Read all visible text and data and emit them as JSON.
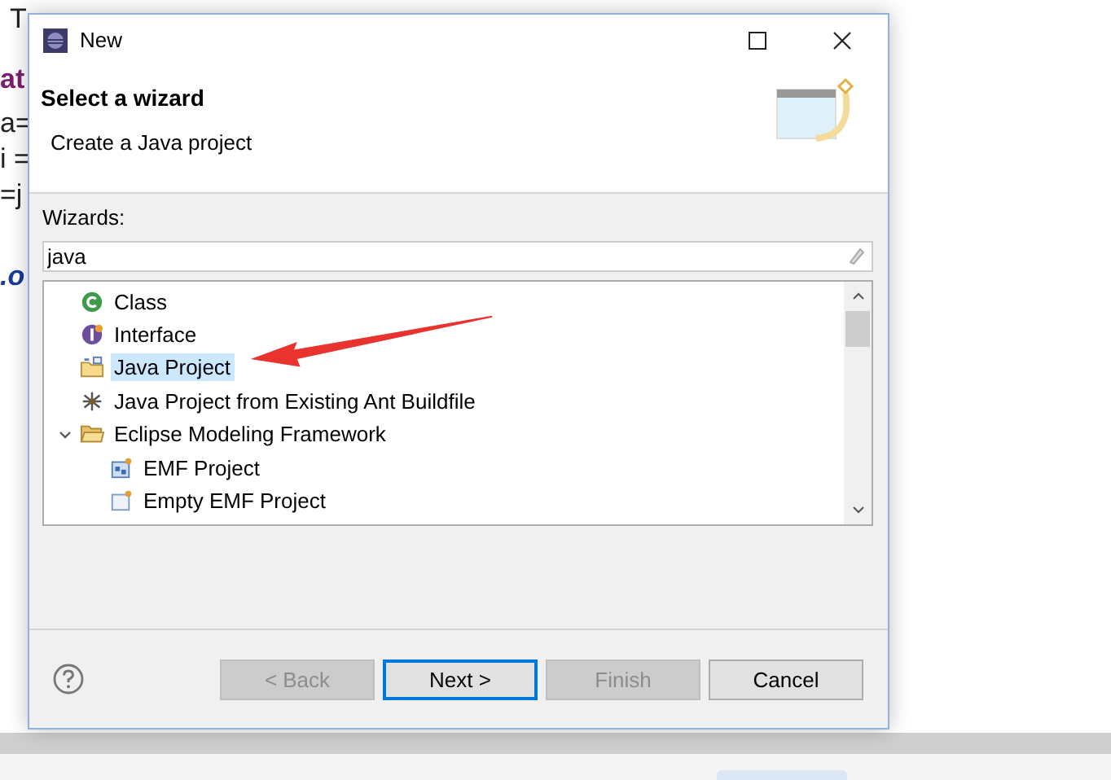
{
  "editor_fragments": [
    {
      "text": "T",
      "kind": "plain"
    },
    {
      "text": "at",
      "kind": "keyword"
    },
    {
      "text": "a=",
      "kind": "plain"
    },
    {
      "text": "i =",
      "kind": "plain"
    },
    {
      "text": "=j",
      "kind": "plain"
    },
    {
      "text": ".o",
      "kind": "field"
    }
  ],
  "window": {
    "title": "New"
  },
  "header": {
    "title": "Select a wizard",
    "description": "Create a Java project"
  },
  "wizards_label": "Wizards:",
  "filter": {
    "value": "java"
  },
  "tree": [
    {
      "label": "Class",
      "kind": "class",
      "selected": false
    },
    {
      "label": "Interface",
      "kind": "interface",
      "selected": false
    },
    {
      "label": "Java Project",
      "kind": "project",
      "selected": true
    },
    {
      "label": "Java Project from Existing Ant Buildfile",
      "kind": "ant",
      "selected": false
    },
    {
      "label": "Eclipse Modeling Framework",
      "kind": "folder",
      "selected": false,
      "expanded": true,
      "children": [
        {
          "label": "EMF Project",
          "kind": "emf",
          "selected": false
        },
        {
          "label": "Empty EMF Project",
          "kind": "empty-emf",
          "selected": false
        }
      ]
    }
  ],
  "buttons": [
    {
      "label": "< Back",
      "disabled": true,
      "default": false
    },
    {
      "label": "Next >",
      "disabled": false,
      "default": true
    },
    {
      "label": "Finish",
      "disabled": true,
      "default": false
    },
    {
      "label": "Cancel",
      "disabled": false,
      "default": false
    }
  ]
}
